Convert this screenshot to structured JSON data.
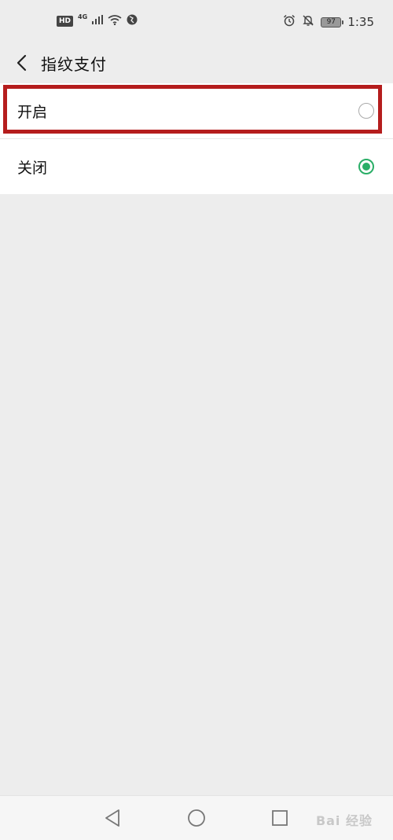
{
  "status_bar": {
    "hd": "HD",
    "network": "4G",
    "battery": "97",
    "time": "1:35",
    "icons": [
      "signal-icon",
      "wifi-icon",
      "globe-icon",
      "alarm-icon",
      "bell-off-icon"
    ]
  },
  "header": {
    "title": "指纹支付"
  },
  "options": [
    {
      "label": "开启",
      "selected": false
    },
    {
      "label": "关闭",
      "selected": true
    }
  ],
  "colors": {
    "accent": "#2aae67",
    "highlight": "#b51d1d",
    "background": "#ededed"
  },
  "bottom_nav": {
    "icons": [
      "back-triangle-icon",
      "home-circle-icon",
      "recents-square-icon"
    ]
  },
  "watermark": "Bai 经验"
}
